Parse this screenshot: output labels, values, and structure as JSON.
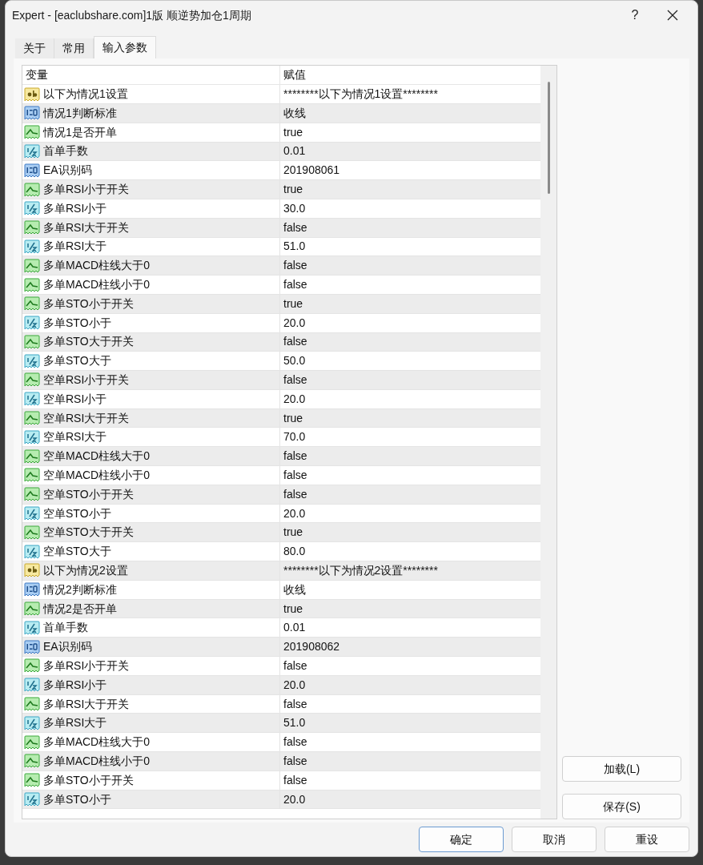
{
  "window": {
    "title": "Expert - [eaclubshare.com]1版  顺逆势加仓1周期",
    "help": "?"
  },
  "tabs": [
    {
      "label": "关于",
      "selected": false
    },
    {
      "label": "常用",
      "selected": false
    },
    {
      "label": "输入参数",
      "selected": true
    }
  ],
  "table": {
    "columns": [
      "变量",
      "赋值"
    ],
    "rows": [
      {
        "kind": "string",
        "name": "以下为情况1设置",
        "value": "********以下为情况1设置********"
      },
      {
        "kind": "int",
        "name": "情况1判断标准",
        "value": "收线"
      },
      {
        "kind": "bool",
        "name": "情况1是否开单",
        "value": "true"
      },
      {
        "kind": "double",
        "name": "首单手数",
        "value": "0.01"
      },
      {
        "kind": "int",
        "name": "EA识别码",
        "value": "201908061"
      },
      {
        "kind": "bool",
        "name": "多单RSI小于开关",
        "value": "true"
      },
      {
        "kind": "double",
        "name": "多单RSI小于",
        "value": "30.0"
      },
      {
        "kind": "bool",
        "name": "多单RSI大于开关",
        "value": "false"
      },
      {
        "kind": "double",
        "name": "多单RSI大于",
        "value": "51.0"
      },
      {
        "kind": "bool",
        "name": "多单MACD柱线大于0",
        "value": "false"
      },
      {
        "kind": "bool",
        "name": "多单MACD柱线小于0",
        "value": "false"
      },
      {
        "kind": "bool",
        "name": "多单STO小于开关",
        "value": "true"
      },
      {
        "kind": "double",
        "name": "多单STO小于",
        "value": "20.0"
      },
      {
        "kind": "bool",
        "name": "多单STO大于开关",
        "value": "false"
      },
      {
        "kind": "double",
        "name": "多单STO大于",
        "value": "50.0"
      },
      {
        "kind": "bool",
        "name": "空单RSI小于开关",
        "value": "false"
      },
      {
        "kind": "double",
        "name": "空单RSI小于",
        "value": "20.0"
      },
      {
        "kind": "bool",
        "name": "空单RSI大于开关",
        "value": "true"
      },
      {
        "kind": "double",
        "name": "空单RSI大于",
        "value": "70.0"
      },
      {
        "kind": "bool",
        "name": "空单MACD柱线大于0",
        "value": "false"
      },
      {
        "kind": "bool",
        "name": "空单MACD柱线小于0",
        "value": "false"
      },
      {
        "kind": "bool",
        "name": "空单STO小于开关",
        "value": "false"
      },
      {
        "kind": "double",
        "name": "空单STO小于",
        "value": "20.0"
      },
      {
        "kind": "bool",
        "name": "空单STO大于开关",
        "value": "true"
      },
      {
        "kind": "double",
        "name": "空单STO大于",
        "value": "80.0"
      },
      {
        "kind": "string",
        "name": "以下为情况2设置",
        "value": "********以下为情况2设置********"
      },
      {
        "kind": "int",
        "name": "情况2判断标准",
        "value": "收线"
      },
      {
        "kind": "bool",
        "name": "情况2是否开单",
        "value": "true"
      },
      {
        "kind": "double",
        "name": "首单手数",
        "value": "0.01"
      },
      {
        "kind": "int",
        "name": "EA识别码",
        "value": "201908062"
      },
      {
        "kind": "bool",
        "name": "多单RSI小于开关",
        "value": "false"
      },
      {
        "kind": "double",
        "name": "多单RSI小于",
        "value": "20.0"
      },
      {
        "kind": "bool",
        "name": "多单RSI大于开关",
        "value": "false"
      },
      {
        "kind": "double",
        "name": "多单RSI大于",
        "value": "51.0"
      },
      {
        "kind": "bool",
        "name": "多单MACD柱线大于0",
        "value": "false"
      },
      {
        "kind": "bool",
        "name": "多单MACD柱线小于0",
        "value": "false"
      },
      {
        "kind": "bool",
        "name": "多单STO小于开关",
        "value": "false"
      },
      {
        "kind": "double",
        "name": "多单STO小于",
        "value": "20.0"
      }
    ]
  },
  "side_buttons": [
    "加载(L)",
    "保存(S)"
  ],
  "buttons": [
    "确定",
    "取消",
    "重设"
  ]
}
